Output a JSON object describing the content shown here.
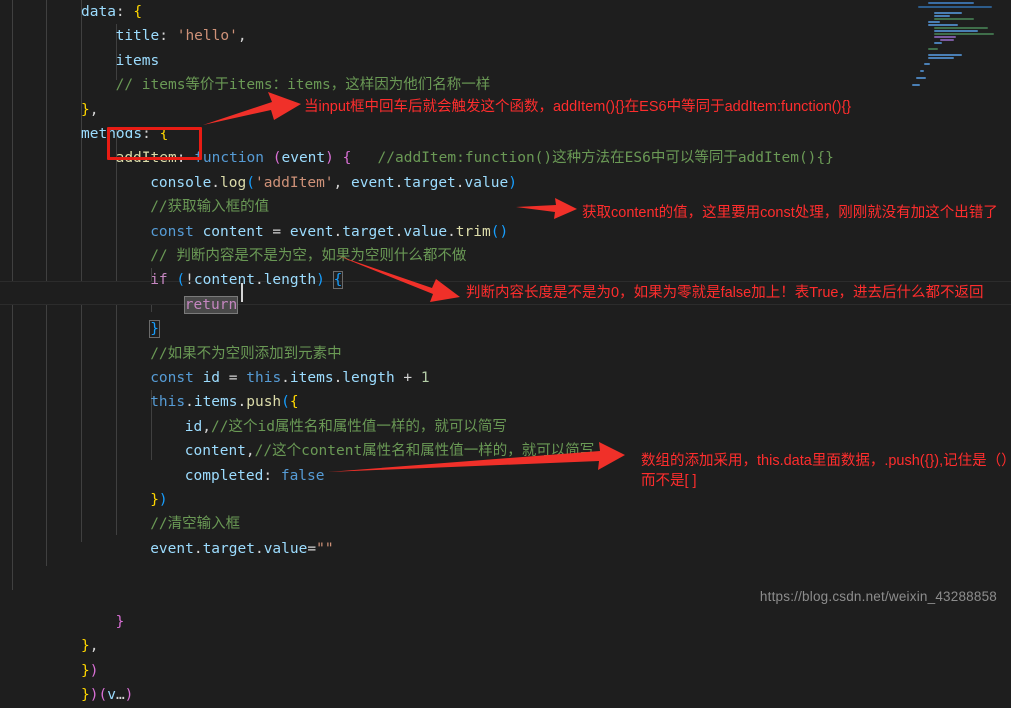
{
  "editor": {
    "theme_background": "#1e1e1e",
    "indent_guide_color": "#404040",
    "font_size_px": 14.5,
    "code_lines": [
      {
        "indent": 0,
        "tokens": [
          {
            "t": "data",
            "c": "var"
          },
          {
            "t": ": ",
            "c": "op"
          },
          {
            "t": "{",
            "c": "p1"
          }
        ]
      },
      {
        "indent": 1,
        "tokens": [
          {
            "t": "title",
            "c": "var"
          },
          {
            "t": ": ",
            "c": "op"
          },
          {
            "t": "'hello'",
            "c": "str"
          },
          {
            "t": ",",
            "c": "op"
          }
        ]
      },
      {
        "indent": 1,
        "tokens": [
          {
            "t": "items",
            "c": "var"
          }
        ]
      },
      {
        "indent": 1,
        "tokens": [
          {
            "t": "// items等价于items：items，这样因为他们名称一样",
            "c": "cmt"
          }
        ]
      },
      {
        "indent": 0,
        "tokens": [
          {
            "t": "}",
            "c": "p1"
          },
          {
            "t": ",",
            "c": "op"
          }
        ]
      },
      {
        "indent": 0,
        "tokens": [
          {
            "t": "methods",
            "c": "var"
          },
          {
            "t": ": ",
            "c": "op"
          },
          {
            "t": "{",
            "c": "p1"
          }
        ]
      },
      {
        "indent": 1,
        "tokens": [
          {
            "t": "addItem",
            "c": "fn"
          },
          {
            "t": ":",
            "c": "op"
          },
          {
            "t": " ",
            "c": "op"
          },
          {
            "t": "function",
            "c": "k"
          },
          {
            "t": " ",
            "c": "op"
          },
          {
            "t": "(",
            "c": "p2"
          },
          {
            "t": "event",
            "c": "var"
          },
          {
            "t": ")",
            "c": "p2"
          },
          {
            "t": " ",
            "c": "op"
          },
          {
            "t": "{",
            "c": "p2"
          },
          {
            "t": "   ",
            "c": "op"
          },
          {
            "t": "//addItem:function()这种方法在ES6中可以等同于addItem(){}",
            "c": "cmt"
          }
        ]
      },
      {
        "indent": 2,
        "tokens": [
          {
            "t": "console",
            "c": "var"
          },
          {
            "t": ".",
            "c": "op"
          },
          {
            "t": "log",
            "c": "fn"
          },
          {
            "t": "(",
            "c": "p3"
          },
          {
            "t": "'addItem'",
            "c": "str"
          },
          {
            "t": ", ",
            "c": "op"
          },
          {
            "t": "event",
            "c": "var"
          },
          {
            "t": ".",
            "c": "op"
          },
          {
            "t": "target",
            "c": "var"
          },
          {
            "t": ".",
            "c": "op"
          },
          {
            "t": "value",
            "c": "var"
          },
          {
            "t": ")",
            "c": "p3"
          }
        ]
      },
      {
        "indent": 2,
        "tokens": [
          {
            "t": "//获取输入框的值",
            "c": "cmt"
          }
        ]
      },
      {
        "indent": 2,
        "tokens": [
          {
            "t": "const",
            "c": "k"
          },
          {
            "t": " ",
            "c": "op"
          },
          {
            "t": "content",
            "c": "var"
          },
          {
            "t": " = ",
            "c": "op"
          },
          {
            "t": "event",
            "c": "var"
          },
          {
            "t": ".",
            "c": "op"
          },
          {
            "t": "target",
            "c": "var"
          },
          {
            "t": ".",
            "c": "op"
          },
          {
            "t": "value",
            "c": "var"
          },
          {
            "t": ".",
            "c": "op"
          },
          {
            "t": "trim",
            "c": "fn"
          },
          {
            "t": "()",
            "c": "p3"
          }
        ]
      },
      {
        "indent": 2,
        "tokens": [
          {
            "t": "// 判断内容是不是为空，如果为空则什么都不做",
            "c": "cmt"
          }
        ]
      },
      {
        "indent": 2,
        "tokens": [
          {
            "t": "if",
            "c": "ctrl"
          },
          {
            "t": " ",
            "c": "op"
          },
          {
            "t": "(",
            "c": "p3"
          },
          {
            "t": "!",
            "c": "op"
          },
          {
            "t": "content",
            "c": "var"
          },
          {
            "t": ".",
            "c": "op"
          },
          {
            "t": "length",
            "c": "var"
          },
          {
            "t": ")",
            "c": "p3"
          },
          {
            "t": " ",
            "c": "op"
          },
          {
            "t": "{",
            "c": "p3",
            "match": true
          }
        ]
      },
      {
        "indent": 3,
        "tokens": [
          {
            "t": "return",
            "c": "ctrl",
            "sel": true
          }
        ]
      },
      {
        "indent": 2,
        "tokens": [
          {
            "t": "}",
            "c": "p3",
            "match": true
          }
        ]
      },
      {
        "indent": 2,
        "tokens": [
          {
            "t": "//如果不为空则添加到元素中",
            "c": "cmt"
          }
        ]
      },
      {
        "indent": 2,
        "tokens": [
          {
            "t": "const",
            "c": "k"
          },
          {
            "t": " ",
            "c": "op"
          },
          {
            "t": "id",
            "c": "var"
          },
          {
            "t": " = ",
            "c": "op"
          },
          {
            "t": "this",
            "c": "k"
          },
          {
            "t": ".",
            "c": "op"
          },
          {
            "t": "items",
            "c": "var"
          },
          {
            "t": ".",
            "c": "op"
          },
          {
            "t": "length",
            "c": "var"
          },
          {
            "t": " ",
            "c": "op"
          },
          {
            "t": "+",
            "c": "op"
          },
          {
            "t": " ",
            "c": "op"
          },
          {
            "t": "1",
            "c": "num"
          }
        ]
      },
      {
        "indent": 2,
        "tokens": [
          {
            "t": "this",
            "c": "k"
          },
          {
            "t": ".",
            "c": "op"
          },
          {
            "t": "items",
            "c": "var"
          },
          {
            "t": ".",
            "c": "op"
          },
          {
            "t": "push",
            "c": "fn"
          },
          {
            "t": "(",
            "c": "p3"
          },
          {
            "t": "{",
            "c": "p1"
          }
        ]
      },
      {
        "indent": 3,
        "tokens": [
          {
            "t": "id",
            "c": "var"
          },
          {
            "t": ",",
            "c": "op"
          },
          {
            "t": "//这个id属性名和属性值一样的，就可以简写",
            "c": "cmt"
          }
        ]
      },
      {
        "indent": 3,
        "tokens": [
          {
            "t": "content",
            "c": "var"
          },
          {
            "t": ",",
            "c": "op"
          },
          {
            "t": "//这个content属性名和属性值一样的，就可以简写",
            "c": "cmt"
          }
        ]
      },
      {
        "indent": 3,
        "tokens": [
          {
            "t": "completed",
            "c": "var"
          },
          {
            "t": ": ",
            "c": "op"
          },
          {
            "t": "false",
            "c": "k"
          }
        ]
      },
      {
        "indent": 2,
        "tokens": [
          {
            "t": "}",
            "c": "p1"
          },
          {
            "t": ")",
            "c": "p3"
          }
        ]
      },
      {
        "indent": 2,
        "tokens": [
          {
            "t": "//清空输入框",
            "c": "cmt"
          }
        ]
      },
      {
        "indent": 2,
        "tokens": [
          {
            "t": "event",
            "c": "var"
          },
          {
            "t": ".",
            "c": "op"
          },
          {
            "t": "target",
            "c": "var"
          },
          {
            "t": ".",
            "c": "op"
          },
          {
            "t": "value",
            "c": "var"
          },
          {
            "t": "=",
            "c": "op"
          },
          {
            "t": "\"\"",
            "c": "str"
          }
        ]
      },
      {
        "indent": 0,
        "tokens": []
      },
      {
        "indent": 0,
        "tokens": []
      },
      {
        "indent": 1,
        "tokens": [
          {
            "t": "}",
            "c": "p2"
          }
        ]
      },
      {
        "indent": 0,
        "tokens": [
          {
            "t": "}",
            "c": "p1"
          },
          {
            "t": ",",
            "c": "op"
          }
        ]
      },
      {
        "indent": 0,
        "tokens": [
          {
            "t": "}",
            "c": "p1"
          },
          {
            "t": ")",
            "c": "p2"
          }
        ]
      },
      {
        "indent": 0,
        "tokens": [
          {
            "t": "}",
            "c": "p1"
          },
          {
            "t": ")",
            "c": "p2"
          },
          {
            "t": "(",
            "c": "p2"
          },
          {
            "t": "v",
            "c": "var"
          },
          {
            "t": "…",
            "c": "op"
          },
          {
            "t": ")",
            "c": "p2"
          }
        ]
      }
    ]
  },
  "highlight_box": {
    "label": "addItem:",
    "color": "#e81c14"
  },
  "annotations": [
    {
      "id": "note-trigger-function",
      "text": "当input框中回车后就会触发这个函数，addItem(){}在ES6中等同于addItem:function(){}",
      "color": "#ff2d2d"
    },
    {
      "id": "note-const-content",
      "text": "获取content的值，这里要用const处理，刚刚就没有加这个出错了",
      "color": "#ff2d2d"
    },
    {
      "id": "note-length-check",
      "text": "判断内容长度是不是为0，如果为零就是false加上！表True，进去后什么都不返回",
      "color": "#ff2d2d"
    },
    {
      "id": "note-array-push",
      "text": "数组的添加采用，this.data里面数据，.push({}),记住是（）而不是[ ]",
      "color": "#ff2d2d"
    }
  ],
  "watermark": {
    "text": "https://blog.csdn.net/weixin_43288858"
  }
}
